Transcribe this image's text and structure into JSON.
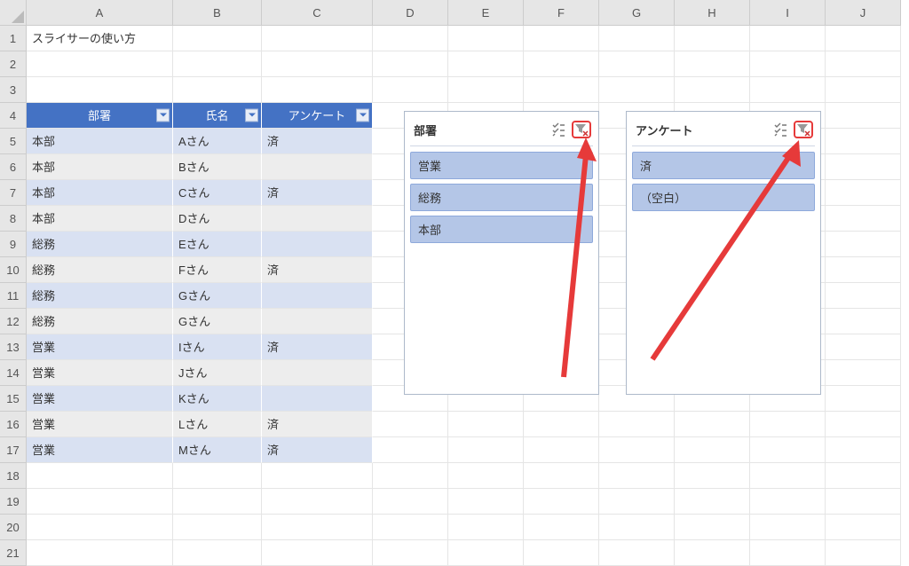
{
  "columns": [
    "A",
    "B",
    "C",
    "D",
    "E",
    "F",
    "G",
    "H",
    "I",
    "J"
  ],
  "rows": [
    "1",
    "2",
    "3",
    "4",
    "5",
    "6",
    "7",
    "8",
    "9",
    "10",
    "11",
    "12",
    "13",
    "14",
    "15",
    "16",
    "17",
    "18",
    "19",
    "20",
    "21"
  ],
  "title_cell": "スライサーの使い方",
  "table_headers": [
    "部署",
    "氏名",
    "アンケート"
  ],
  "table_data": [
    {
      "dept": "本部",
      "name": "Aさん",
      "ans": "済"
    },
    {
      "dept": "本部",
      "name": "Bさん",
      "ans": ""
    },
    {
      "dept": "本部",
      "name": "Cさん",
      "ans": "済"
    },
    {
      "dept": "本部",
      "name": "Dさん",
      "ans": ""
    },
    {
      "dept": "総務",
      "name": "Eさん",
      "ans": ""
    },
    {
      "dept": "総務",
      "name": "Fさん",
      "ans": "済"
    },
    {
      "dept": "総務",
      "name": "Gさん",
      "ans": ""
    },
    {
      "dept": "総務",
      "name": "Gさん",
      "ans": ""
    },
    {
      "dept": "営業",
      "name": "Iさん",
      "ans": "済"
    },
    {
      "dept": "営業",
      "name": "Jさん",
      "ans": ""
    },
    {
      "dept": "営業",
      "name": "Kさん",
      "ans": ""
    },
    {
      "dept": "営業",
      "name": "Lさん",
      "ans": "済"
    },
    {
      "dept": "営業",
      "name": "Mさん",
      "ans": "済"
    }
  ],
  "slicer1": {
    "title": "部署",
    "items": [
      "営業",
      "総務",
      "本部"
    ]
  },
  "slicer2": {
    "title": "アンケート",
    "items": [
      "済",
      "（空白）"
    ]
  }
}
